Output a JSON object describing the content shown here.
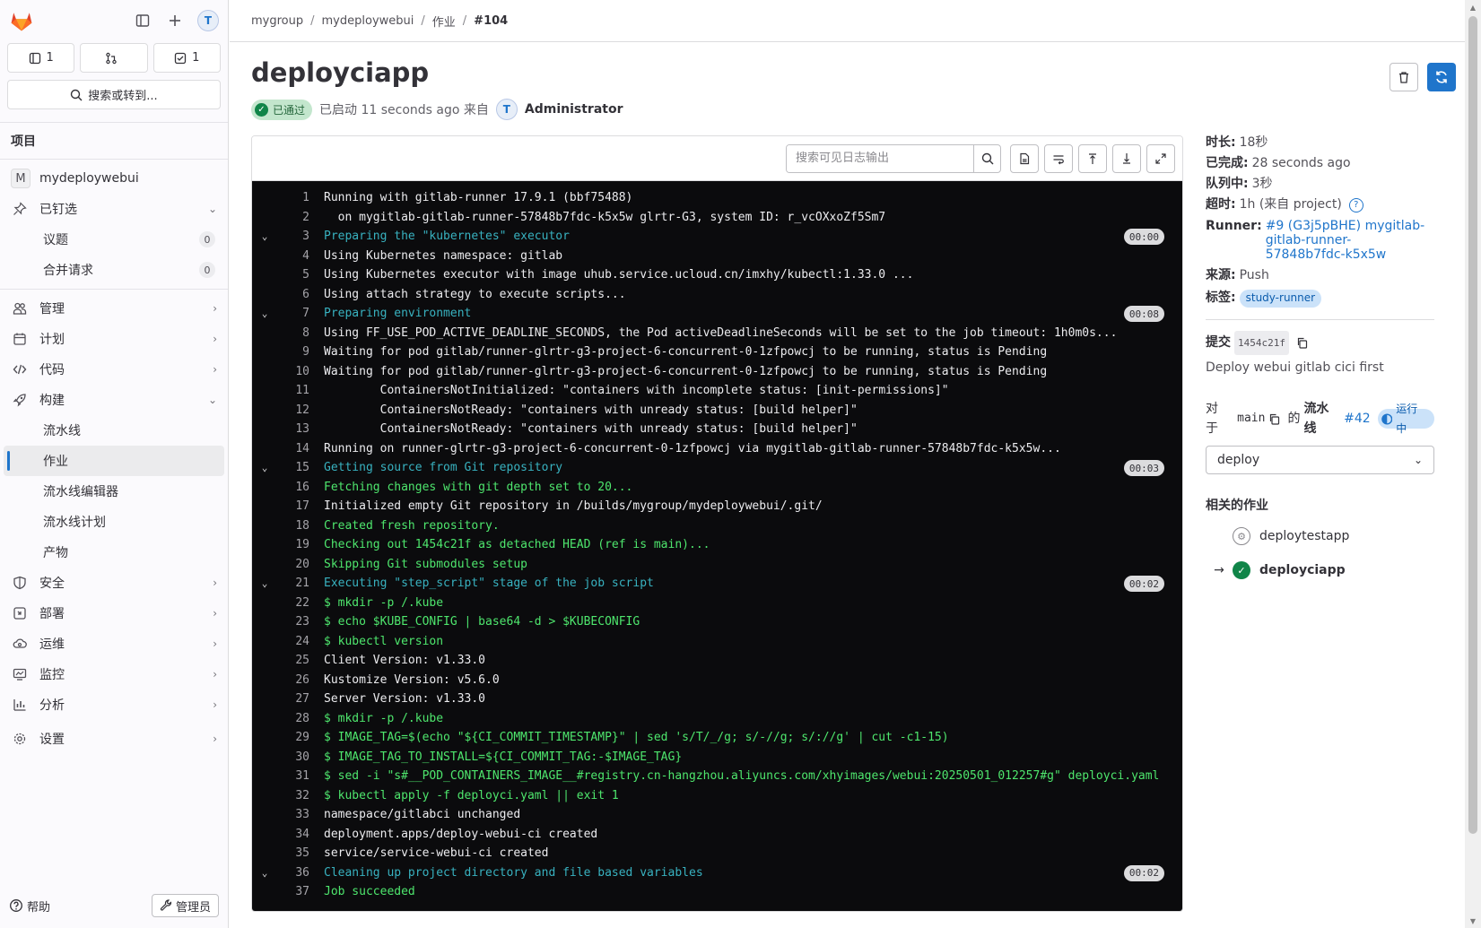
{
  "sidebar": {
    "counters": [
      {
        "icon": "issues-icon",
        "count": "1"
      },
      {
        "icon": "merge-request-icon",
        "count": ""
      },
      {
        "icon": "todo-icon",
        "count": "1"
      }
    ],
    "search_label": "搜索或转到...",
    "section_title": "项目",
    "project_initial": "M",
    "project_name": "mydeploywebui",
    "pinned_label": "已钉选",
    "pinned_items": [
      {
        "label": "议题",
        "count": "0"
      },
      {
        "label": "合并请求",
        "count": "0"
      }
    ],
    "nav_items": {
      "manage": "管理",
      "plan": "计划",
      "code": "代码",
      "build": "构建",
      "secure": "安全",
      "deploy": "部署",
      "operate": "运维",
      "monitor": "监控",
      "analyze": "分析",
      "settings": "设置"
    },
    "build_sub": [
      "流水线",
      "作业",
      "流水线编辑器",
      "流水线计划",
      "产物"
    ],
    "help_label": "帮助",
    "admin_label": "管理员"
  },
  "breadcrumb": [
    "mygroup",
    "mydeploywebui",
    "作业",
    "#104"
  ],
  "job": {
    "title": "deployciapp",
    "status": "已通过",
    "started_text": "已启动 11 seconds ago 来自",
    "user": "Administrator"
  },
  "log": {
    "search_placeholder": "搜索可见日志输出",
    "lines": [
      {
        "n": "1",
        "t": "Running with gitlab-runner 17.9.1 (bbf75488)",
        "k": "plain"
      },
      {
        "n": "2",
        "t": "  on mygitlab-gitlab-runner-57848b7fdc-k5x5w glrtr-G3, system ID: r_vcOXxoZf5Sm7",
        "k": "plain"
      },
      {
        "n": "3",
        "t": "Preparing the \"kubernetes\" executor",
        "k": "section",
        "d": "00:00"
      },
      {
        "n": "4",
        "t": "Using Kubernetes namespace: gitlab",
        "k": "plain"
      },
      {
        "n": "5",
        "t": "Using Kubernetes executor with image uhub.service.ucloud.cn/imxhy/kubectl:1.33.0 ...",
        "k": "plain"
      },
      {
        "n": "6",
        "t": "Using attach strategy to execute scripts...",
        "k": "plain"
      },
      {
        "n": "7",
        "t": "Preparing environment",
        "k": "section",
        "d": "00:08"
      },
      {
        "n": "8",
        "t": "Using FF_USE_POD_ACTIVE_DEADLINE_SECONDS, the Pod activeDeadlineSeconds will be set to the job timeout: 1h0m0s...",
        "k": "plain"
      },
      {
        "n": "9",
        "t": "Waiting for pod gitlab/runner-glrtr-g3-project-6-concurrent-0-1zfpowcj to be running, status is Pending",
        "k": "plain"
      },
      {
        "n": "10",
        "t": "Waiting for pod gitlab/runner-glrtr-g3-project-6-concurrent-0-1zfpowcj to be running, status is Pending",
        "k": "plain"
      },
      {
        "n": "11",
        "t": "\tContainersNotInitialized: \"containers with incomplete status: [init-permissions]\"",
        "k": "plain"
      },
      {
        "n": "12",
        "t": "\tContainersNotReady: \"containers with unready status: [build helper]\"",
        "k": "plain"
      },
      {
        "n": "13",
        "t": "\tContainersNotReady: \"containers with unready status: [build helper]\"",
        "k": "plain"
      },
      {
        "n": "14",
        "t": "Running on runner-glrtr-g3-project-6-concurrent-0-1zfpowcj via mygitlab-gitlab-runner-57848b7fdc-k5x5w...",
        "k": "plain"
      },
      {
        "n": "15",
        "t": "Getting source from Git repository",
        "k": "section",
        "d": "00:03"
      },
      {
        "n": "16",
        "t": "Fetching changes with git depth set to 20...",
        "k": "green"
      },
      {
        "n": "17",
        "t": "Initialized empty Git repository in /builds/mygroup/mydeploywebui/.git/",
        "k": "plain"
      },
      {
        "n": "18",
        "t": "Created fresh repository.",
        "k": "green"
      },
      {
        "n": "19",
        "t": "Checking out 1454c21f as detached HEAD (ref is main)...",
        "k": "green"
      },
      {
        "n": "20",
        "t": "Skipping Git submodules setup",
        "k": "green"
      },
      {
        "n": "21",
        "t": "Executing \"step_script\" stage of the job script",
        "k": "section",
        "d": "00:02"
      },
      {
        "n": "22",
        "t": "$ mkdir -p /.kube",
        "k": "green"
      },
      {
        "n": "23",
        "t": "$ echo $KUBE_CONFIG | base64 -d > $KUBECONFIG",
        "k": "green"
      },
      {
        "n": "24",
        "t": "$ kubectl version",
        "k": "green"
      },
      {
        "n": "25",
        "t": "Client Version: v1.33.0",
        "k": "plain"
      },
      {
        "n": "26",
        "t": "Kustomize Version: v5.6.0",
        "k": "plain"
      },
      {
        "n": "27",
        "t": "Server Version: v1.33.0",
        "k": "plain"
      },
      {
        "n": "28",
        "t": "$ mkdir -p /.kube",
        "k": "green"
      },
      {
        "n": "29",
        "t": "$ IMAGE_TAG=$(echo \"${CI_COMMIT_TIMESTAMP}\" | sed 's/T/_/g; s/-//g; s/://g' | cut -c1-15)",
        "k": "green"
      },
      {
        "n": "30",
        "t": "$ IMAGE_TAG_TO_INSTALL=${CI_COMMIT_TAG:-$IMAGE_TAG}",
        "k": "green"
      },
      {
        "n": "31",
        "t": "$ sed -i \"s#__POD_CONTAINERS_IMAGE__#registry.cn-hangzhou.aliyuncs.com/xhyimages/webui:20250501_012257#g\" deployci.yaml",
        "k": "green"
      },
      {
        "n": "32",
        "t": "$ kubectl apply -f deployci.yaml || exit 1",
        "k": "green"
      },
      {
        "n": "33",
        "t": "namespace/gitlabci unchanged",
        "k": "plain"
      },
      {
        "n": "34",
        "t": "deployment.apps/deploy-webui-ci created",
        "k": "plain"
      },
      {
        "n": "35",
        "t": "service/service-webui-ci created",
        "k": "plain"
      },
      {
        "n": "36",
        "t": "Cleaning up project directory and file based variables",
        "k": "section",
        "d": "00:02"
      },
      {
        "n": "37",
        "t": "Job succeeded",
        "k": "green"
      }
    ]
  },
  "details": {
    "duration_k": "时长:",
    "duration_v": "18秒",
    "finished_k": "已完成:",
    "finished_v": "28 seconds ago",
    "queued_k": "队列中:",
    "queued_v": "3秒",
    "timeout_k": "超时:",
    "timeout_v": "1h (来自 project)",
    "runner_k": "Runner:",
    "runner_v": "#9 (G3j5pBHE) mygitlab-gitlab-runner-57848b7fdc-k5x5w",
    "source_k": "来源:",
    "source_v": "Push",
    "tags_k": "标签:",
    "tag": "study-runner",
    "commit_k": "提交",
    "commit_sha": "1454c21f",
    "commit_msg": "Deploy webui gitlab cici first",
    "pipeline_prefix": "对于",
    "branch": "main",
    "pipeline_of": "的",
    "pipeline_k": "流水线",
    "pipeline_id": "#42",
    "pipeline_status": "运行中",
    "stage": "deploy",
    "related_title": "相关的作业",
    "related_jobs": [
      {
        "name": "deploytestapp",
        "current": false
      },
      {
        "name": "deployciapp",
        "current": true
      }
    ]
  },
  "colors": {
    "accent": "#1f75cb",
    "success": "#108548",
    "log_bg": "#0b0b0d",
    "log_section": "#38b2c0",
    "log_green": "#4ee66d"
  }
}
